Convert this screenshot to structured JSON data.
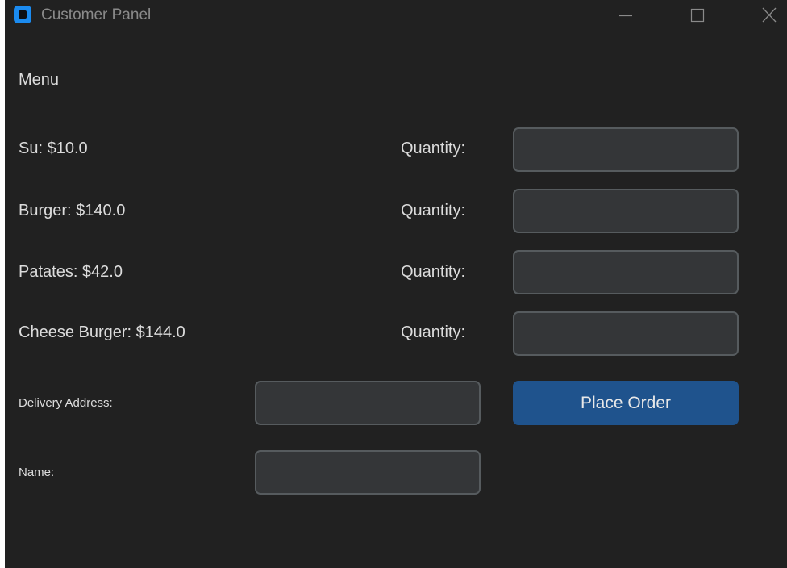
{
  "window": {
    "title": "Customer Panel",
    "controls": [
      "minimize-icon",
      "maximize-icon",
      "close-icon"
    ]
  },
  "menu": {
    "heading": "Menu",
    "items": [
      {
        "label": "Su: $10.0",
        "quantity_label": "Quantity:",
        "quantity_value": ""
      },
      {
        "label": "Burger: $140.0",
        "quantity_label": "Quantity:",
        "quantity_value": ""
      },
      {
        "label": "Patates: $42.0",
        "quantity_label": "Quantity:",
        "quantity_value": ""
      },
      {
        "label": "Cheese Burger: $144.0",
        "quantity_label": "Quantity:",
        "quantity_value": ""
      }
    ]
  },
  "form": {
    "address_label": "Delivery Address:",
    "address_value": "",
    "name_label": "Name:",
    "name_value": "",
    "submit_label": "Place Order"
  },
  "colors": {
    "background": "#212121",
    "accent": "#1f538d",
    "app_icon": "#1b8bf0",
    "field_background": "#343638",
    "field_border": "#565b5e"
  }
}
